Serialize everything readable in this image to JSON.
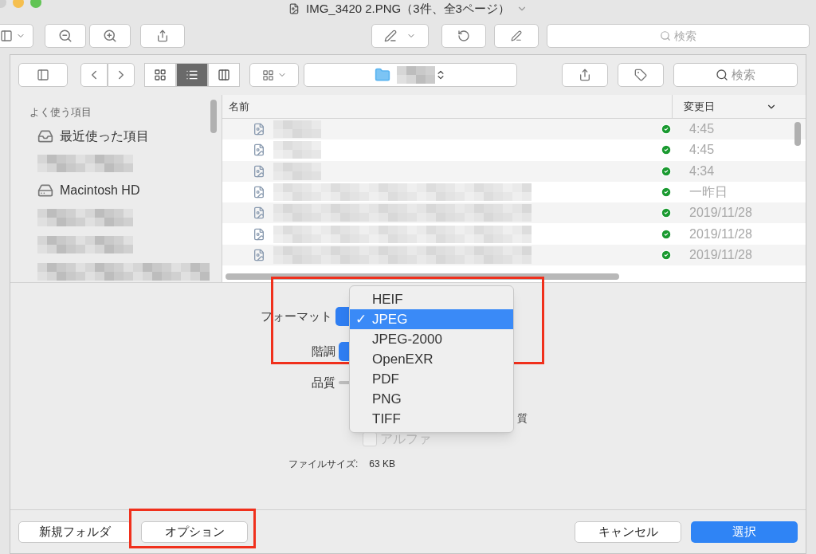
{
  "window": {
    "title": "IMG_3420 2.PNG（3件、全3ページ）"
  },
  "toolbar": {
    "search": {
      "placeholder": "検索"
    }
  },
  "sheet_toolbar": {
    "view_modes": [
      {
        "kind": "icons",
        "selected": false
      },
      {
        "kind": "list",
        "selected": true
      },
      {
        "kind": "columns",
        "selected": false
      }
    ],
    "search": {
      "placeholder": "検索"
    }
  },
  "sidebar": {
    "heading": "よく使う項目",
    "items": [
      {
        "kind": "recents",
        "label": "最近使った項目"
      },
      {
        "kind": "blurred"
      },
      {
        "kind": "disk",
        "label": "Macintosh HD"
      },
      {
        "kind": "blurred"
      },
      {
        "kind": "blurred"
      },
      {
        "kind": "blurred"
      }
    ]
  },
  "file_list": {
    "columns": [
      "名前",
      "変更日"
    ],
    "rows": [
      {
        "date": "4:45",
        "synced": true
      },
      {
        "date": "4:45",
        "synced": true
      },
      {
        "date": "4:34",
        "synced": true
      },
      {
        "date": "一昨日",
        "synced": true
      },
      {
        "date": "2019/11/28",
        "synced": true
      },
      {
        "date": "2019/11/28",
        "synced": true
      },
      {
        "date": "2019/11/28",
        "synced": true
      }
    ]
  },
  "options": {
    "format_label": "フォーマット",
    "depth_label": "階調",
    "quality_label": "品質",
    "partial_text": "質",
    "alpha": {
      "label": "アルファ",
      "checked": false,
      "disabled": true
    },
    "file_size_label": "ファイルサイズ:",
    "file_size": "63 KB"
  },
  "format_menu": {
    "items": [
      {
        "label": "HEIF",
        "selected": false
      },
      {
        "label": "JPEG",
        "selected": true
      },
      {
        "label": "JPEG-2000",
        "selected": false
      },
      {
        "label": "OpenEXR",
        "selected": false
      },
      {
        "label": "PDF",
        "selected": false
      },
      {
        "label": "PNG",
        "selected": false
      },
      {
        "label": "TIFF",
        "selected": false
      }
    ]
  },
  "check_mark": "✓",
  "buttons": {
    "new_folder": "新規フォルダ",
    "options": "オプション",
    "cancel": "キャンセル",
    "choose": "選択"
  }
}
